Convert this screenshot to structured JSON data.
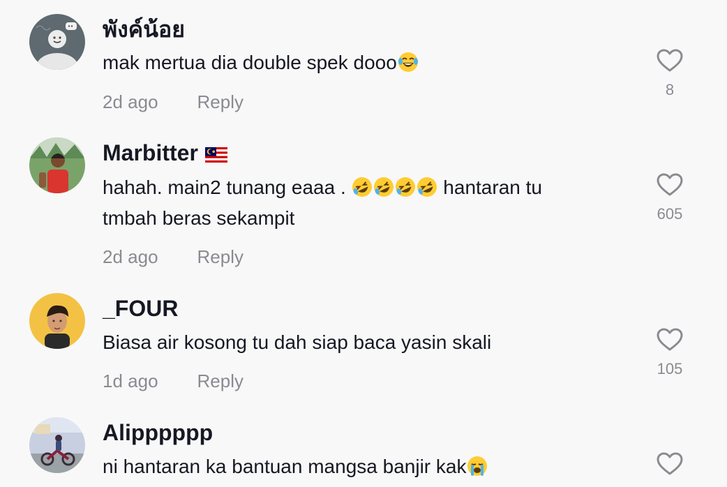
{
  "comments": [
    {
      "username": "พังค์น้อย",
      "text": "mak mertua dia double spek dooo",
      "emoji": "tears-of-joy",
      "time": "2d ago",
      "reply_label": "Reply",
      "likes": "8"
    },
    {
      "username": "Marbitter",
      "flag": "malaysia-flag",
      "text_line1": "hahah. main2 tunang eaaa .",
      "emoji_count": 4,
      "text_line1_tail": "hantaran tu",
      "text_line2": "tmbah beras sekampit",
      "time": "2d ago",
      "reply_label": "Reply",
      "likes": "605"
    },
    {
      "username": "_FOUR",
      "text": "Biasa air kosong tu dah siap baca yasin skali",
      "time": "1d ago",
      "reply_label": "Reply",
      "likes": "105"
    },
    {
      "username": "Alipppppp",
      "text": "ni hantaran ka bantuan mangsa banjir kak",
      "emoji": "loudly-crying",
      "likes": ""
    }
  ],
  "colors": {
    "background": "#f8f8f8",
    "text": "#161823",
    "muted": "#8a8b91",
    "heart_outline": "#8a8b91"
  },
  "icons": {
    "like": "heart-outline-icon",
    "laugh": "rolling-laughing-emoji",
    "joy": "tears-of-joy-emoji",
    "cry": "loudly-crying-emoji"
  }
}
